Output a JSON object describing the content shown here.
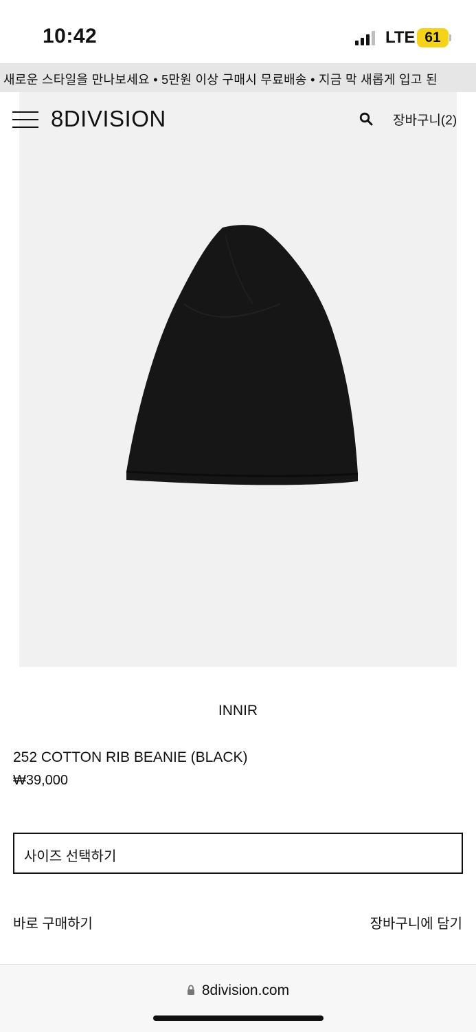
{
  "status_bar": {
    "time": "10:42",
    "network": "LTE",
    "battery": "61",
    "battery_color": "#f5d31b"
  },
  "ticker": {
    "text": "새로운 스타일을 만나보세요  •  5만원 이상 구매시 무료배송  •  지금 막 새롭게 입고 된"
  },
  "header": {
    "logo": "8DIVISION",
    "cart_label": "장바구니(2)",
    "icons": [
      "menu-icon",
      "search-icon"
    ]
  },
  "product": {
    "brand": "INNIR",
    "name": "252 COTTON RIB BEANIE (BLACK)",
    "price": "₩39,000",
    "image": "black-beanie-photo",
    "size_select_label": "사이즈 선택하기",
    "buy_now_label": "바로 구매하기",
    "add_to_cart_label": "장바구니에 담기"
  },
  "browser": {
    "url": "8division.com",
    "icons": [
      "lock-icon"
    ]
  },
  "colors": {
    "background": "#ffffff",
    "ticker_bg": "#e6e6e6",
    "image_bg": "#f1f1f2",
    "text": "#111111"
  }
}
